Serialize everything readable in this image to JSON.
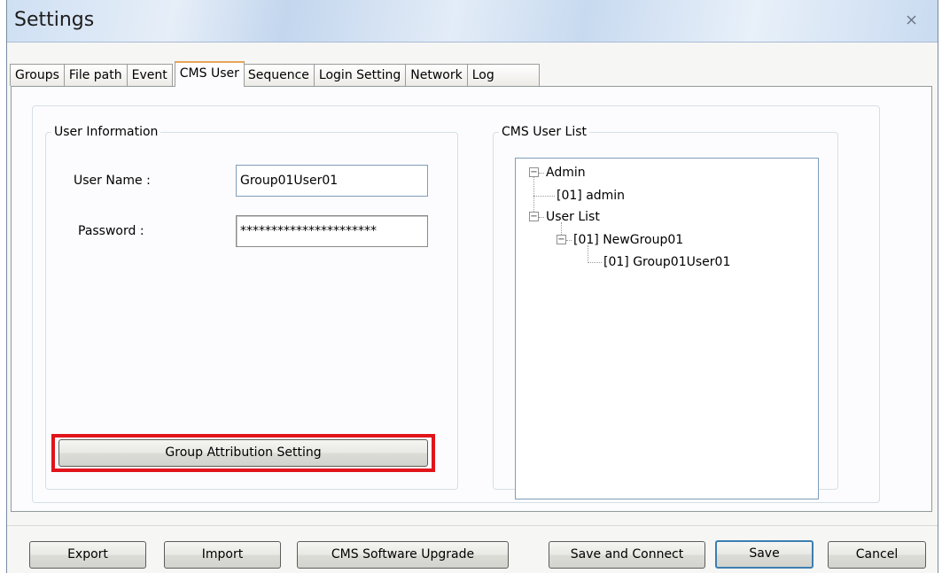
{
  "window": {
    "title": "Settings",
    "close_symbol": "close-icon"
  },
  "tabs": [
    {
      "label": "Groups",
      "active": false
    },
    {
      "label": "File path",
      "active": false
    },
    {
      "label": "Event",
      "active": false
    },
    {
      "label": "CMS User",
      "active": true
    },
    {
      "label": "Sequence",
      "active": false
    },
    {
      "label": "Login Setting",
      "active": false
    },
    {
      "label": "Network",
      "active": false
    },
    {
      "label": "Log",
      "active": false
    }
  ],
  "user_info": {
    "legend": "User Information",
    "username_label": "User Name :",
    "username_value": "Group01User01",
    "password_label": "Password :",
    "password_value": "**********************",
    "group_button": "Group Attribution Setting"
  },
  "user_list": {
    "legend": "CMS User List",
    "nodes": [
      {
        "label": "Admin",
        "expander": "−"
      },
      {
        "label": "[01] admin"
      },
      {
        "label": "User List",
        "expander": "−"
      },
      {
        "label": "[01] NewGroup01",
        "expander": "−"
      },
      {
        "label": "[01] Group01User01"
      }
    ]
  },
  "buttons": {
    "export": "Export",
    "import": "Import",
    "upgrade": "CMS Software Upgrade",
    "save_connect": "Save and Connect",
    "save": "Save",
    "cancel": "Cancel"
  },
  "colors": {
    "highlight": "#e1141b",
    "active_tab_accent": "#e8a55a",
    "default_button_border": "#3c7fb1"
  }
}
